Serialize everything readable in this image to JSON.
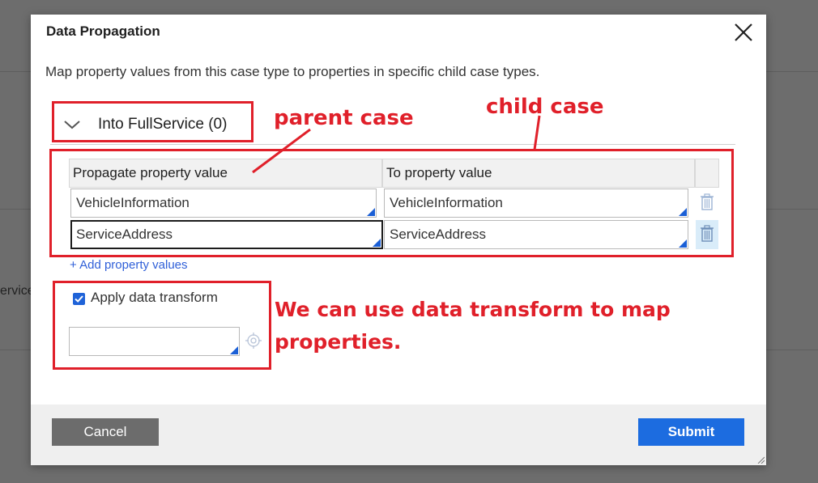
{
  "background": {
    "partial_label": "ervice"
  },
  "dialog": {
    "title": "Data Propagation",
    "description": "Map property values from this case type to properties in specific child case types.",
    "section_label": "Into FullService (0)",
    "table": {
      "headers": [
        "Propagate property value",
        "To property value"
      ],
      "rows": [
        {
          "from": "VehicleInformation",
          "to": "VehicleInformation"
        },
        {
          "from": "ServiceAddress",
          "to": "ServiceAddress"
        }
      ]
    },
    "add_link": "+ Add property values",
    "apply_transform": {
      "label": "Apply data transform",
      "checked": true,
      "value": ""
    },
    "cancel_label": "Cancel",
    "submit_label": "Submit"
  },
  "annotations": {
    "parent_case": "parent case",
    "child_case": "child case",
    "transform_note_line1": "We can use data transform to map",
    "transform_note_line2": "properties."
  },
  "colors": {
    "accent": "#1c6ce0",
    "annotation": "#e0202a",
    "overlay": "#6d6d6d"
  }
}
